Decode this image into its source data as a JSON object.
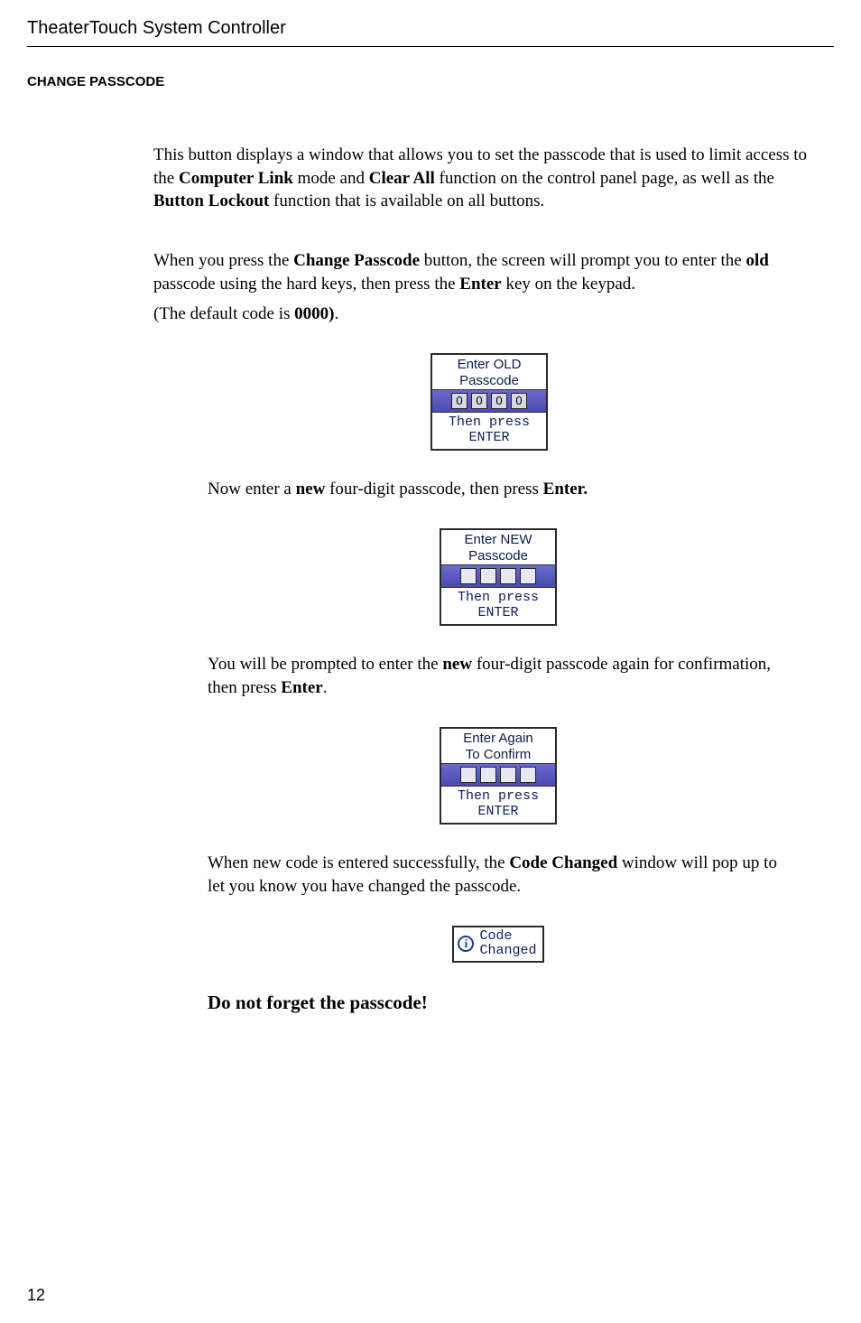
{
  "header": {
    "title": "TheaterTouch System Controller"
  },
  "section": {
    "heading": "CHANGE PASSCODE"
  },
  "p1": {
    "t1": "This button displays a window that allows you to set the passcode that is used to limit access to the ",
    "b1": "Computer Link",
    "t2": " mode and ",
    "b2": "Clear All",
    "t3": " function on the control panel page, as well as the ",
    "b3": "Button Lockout",
    "t4": " function that is available on all buttons."
  },
  "p2": {
    "t1": "When you press the ",
    "b1": "Change Passcode",
    "t2": " button, the screen will prompt you to enter the ",
    "b2": "old",
    "t3": " passcode using the hard keys, then press the ",
    "b3": "Enter",
    "t4": " key on the keypad."
  },
  "p3": {
    "t1": "(The default code is ",
    "b1": "0000)",
    "t2": "."
  },
  "lcd1": {
    "line1": "Enter OLD",
    "line2": "Passcode",
    "digits": [
      "0",
      "0",
      "0",
      "0"
    ],
    "bottom1": "Then press",
    "bottom2": "ENTER"
  },
  "p4": {
    "t1": "Now enter a ",
    "b1": "new",
    "t2": " four-digit passcode, then press ",
    "b2": "Enter.",
    "t3": ""
  },
  "lcd2": {
    "line1": "Enter NEW",
    "line2": "Passcode",
    "bottom1": "Then press",
    "bottom2": "ENTER"
  },
  "p5": {
    "t1": "You will be prompted to enter the ",
    "b1": "new",
    "t2": " four-digit passcode again for confirmation, then press ",
    "b2": "Enter",
    "t3": "."
  },
  "lcd3": {
    "line1": "Enter Again",
    "line2": "To Confirm",
    "bottom1": "Then press",
    "bottom2": "ENTER"
  },
  "p6": {
    "t1": "When new code is entered successfully, the ",
    "b1": "Code Changed",
    "t2": " window will pop up to let you know you have changed the passcode."
  },
  "info": {
    "line1": "Code",
    "line2": "Changed"
  },
  "final": "Do not forget the passcode!",
  "pageNumber": "12"
}
